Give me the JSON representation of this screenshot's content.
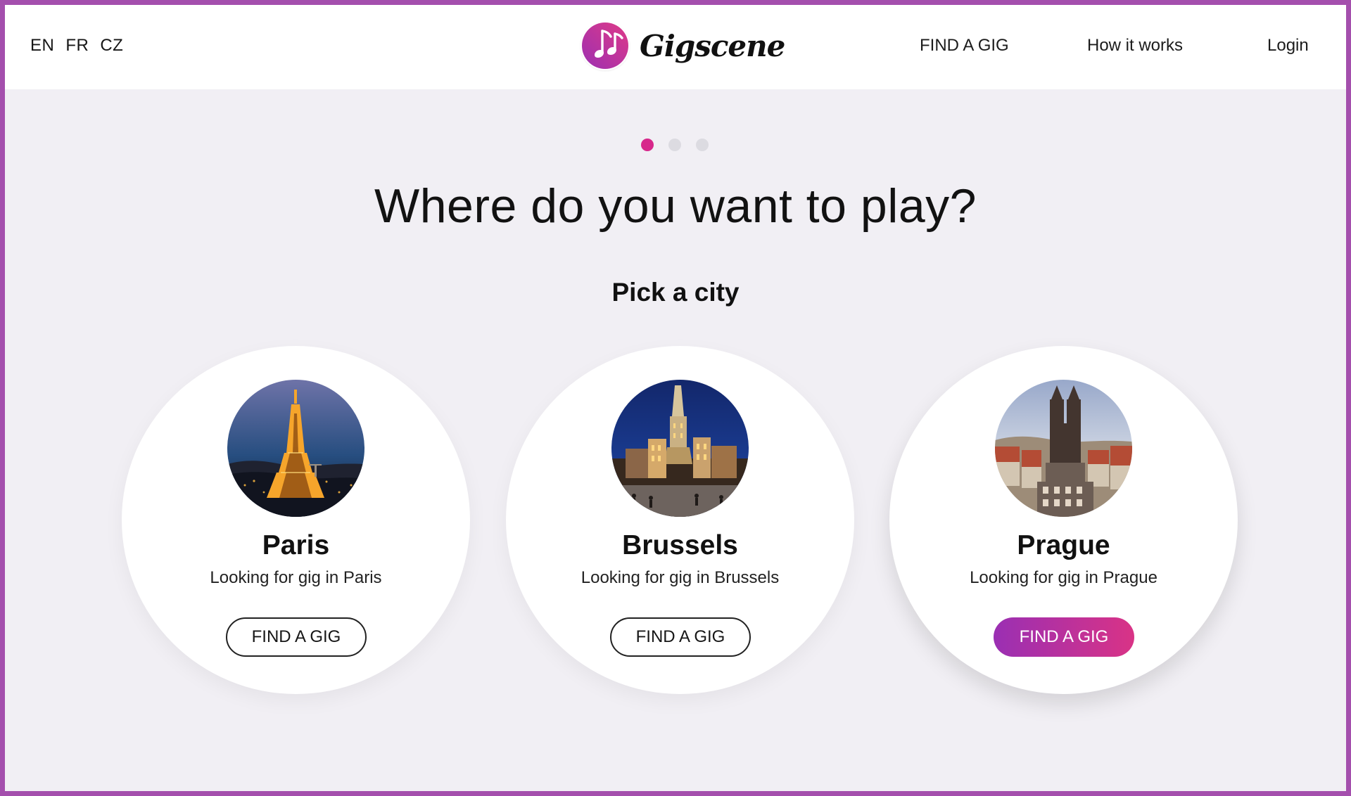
{
  "header": {
    "languages": [
      "EN",
      "FR",
      "CZ"
    ],
    "brand": "Gigscene",
    "nav": {
      "find_a_gig": "FIND A GIG",
      "how_it_works": "How it works",
      "login": "Login"
    }
  },
  "hero": {
    "title": "Where do you want to play?",
    "subtitle": "Pick a city",
    "carousel_active_index": 1,
    "carousel_total": 3
  },
  "cities": [
    {
      "name": "Paris",
      "description": "Looking for gig in Paris",
      "button_label": "FIND A GIG"
    },
    {
      "name": "Brussels",
      "description": "Looking for gig in Brussels",
      "button_label": "FIND A GIG"
    },
    {
      "name": "Prague",
      "description": "Looking for gig in Prague",
      "button_label": "FIND A GIG"
    }
  ],
  "colors": {
    "frame": "#a44fad",
    "accent": "#d7278b",
    "accent_gradient_start": "#9a2fb3",
    "accent_gradient_end": "#d93386",
    "page_background": "#f1eff4",
    "card_background": "#ffffff"
  },
  "icons": {
    "brand_logo": "music-notes-logo-icon",
    "paris_image": "eiffel-tower-icon",
    "brussels_image": "grand-place-icon",
    "prague_image": "prague-towers-icon"
  }
}
